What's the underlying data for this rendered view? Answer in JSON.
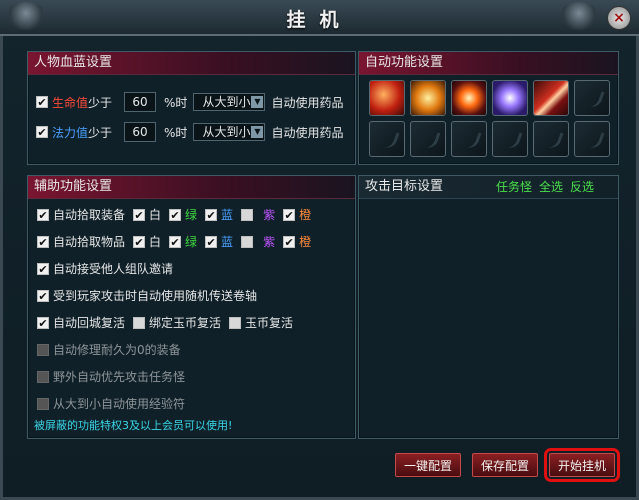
{
  "title": "挂机",
  "hp_mp": {
    "heading": "人物血蓝设置",
    "hp": {
      "label_colored": "生命值",
      "label_after": "少于",
      "value": "60",
      "unit": "%时",
      "order": "从大到小",
      "action": "自动使用药品"
    },
    "mp": {
      "label_colored": "法力值",
      "label_after": "少于",
      "value": "60",
      "unit": "%时",
      "order": "从大到小",
      "action": "自动使用药品"
    }
  },
  "auto_skills": {
    "heading": "自动功能设置"
  },
  "assist": {
    "heading": "辅助功能设置",
    "pick_equip": "自动拾取装备",
    "pick_item": "自动拾取物品",
    "colors": {
      "white": "白",
      "green": "绿",
      "blue": "蓝",
      "purple": "紫",
      "orange": "橙"
    },
    "accept_team": "自动接受他人组队邀请",
    "teleport": "受到玩家攻击时自动使用随机传送卷轴",
    "revive_city": "自动回城复活",
    "bound_jade_revive": "绑定玉币复活",
    "jade_revive": "玉币复活",
    "repair": "自动修理耐久为0的装备",
    "prefer_quest_monster": "野外自动优先攻击任务怪",
    "exp_charm": "从大到小自动使用经验符",
    "vip_note": "被屏蔽的功能特权3及以上会员可以使用!"
  },
  "target": {
    "heading": "攻击目标设置",
    "quest_monster": "任务怪",
    "select_all": "全选",
    "invert": "反选"
  },
  "buttons": {
    "one_key": "一键配置",
    "save": "保存配置",
    "start": "开始挂机"
  },
  "icons": {
    "close": "×",
    "check": "✔",
    "arrow_down": "▼"
  }
}
